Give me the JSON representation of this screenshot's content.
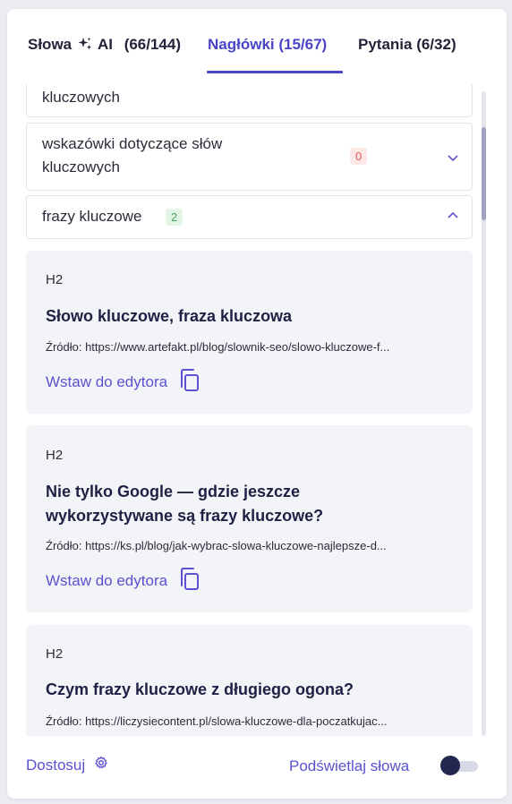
{
  "tabs": [
    {
      "label_prefix": "Słowa",
      "label_suffix": "AI",
      "count": "(66/144)",
      "active": false
    },
    {
      "label": "Nagłówki (15/67)",
      "active": true
    },
    {
      "label": "Pytania (6/32)",
      "active": false
    }
  ],
  "accordion": {
    "partial_row": {
      "label": "kluczowych"
    },
    "rows": [
      {
        "label_line1": "wskazówki dotyczące słów",
        "label_line2": "kluczowych",
        "count": "0",
        "count_color": "#e05757",
        "expanded": false
      },
      {
        "label": "frazy kluczowe",
        "count": "2",
        "count_color": "#47a35a",
        "expanded": true
      }
    ]
  },
  "results": [
    {
      "level": "H2",
      "title": "Słowo kluczowe, fraza kluczowa",
      "source": "Źródło: https://www.artefakt.pl/blog/slownik-seo/slowo-kluczowe-f...",
      "insert_label": "Wstaw do edytora"
    },
    {
      "level": "H2",
      "title_line1": "Nie tylko Google — gdzie jeszcze",
      "title_line2": "wykorzystywane są frazy kluczowe?",
      "source": "Źródło: https://ks.pl/blog/jak-wybrac-slowa-kluczowe-najlepsze-d...",
      "insert_label": "Wstaw do edytora"
    },
    {
      "level": "H2",
      "title": "Czym frazy kluczowe z długiego ogona?",
      "source": "Źródło: https://liczysiecontent.pl/slowa-kluczowe-dla-poczatkujac..."
    }
  ],
  "footer": {
    "customize_label": "Dostosuj",
    "highlight_label": "Podświetlaj słowa",
    "highlight_enabled": false
  },
  "colors": {
    "accent": "#4a44c6",
    "link": "#5a52d0",
    "heading": "#1f2144",
    "result_bg": "#f3f4f8"
  },
  "icons": [
    "sparkle-icon",
    "chevron-down-icon",
    "chevron-up-icon",
    "copy-icon",
    "gear-icon"
  ]
}
